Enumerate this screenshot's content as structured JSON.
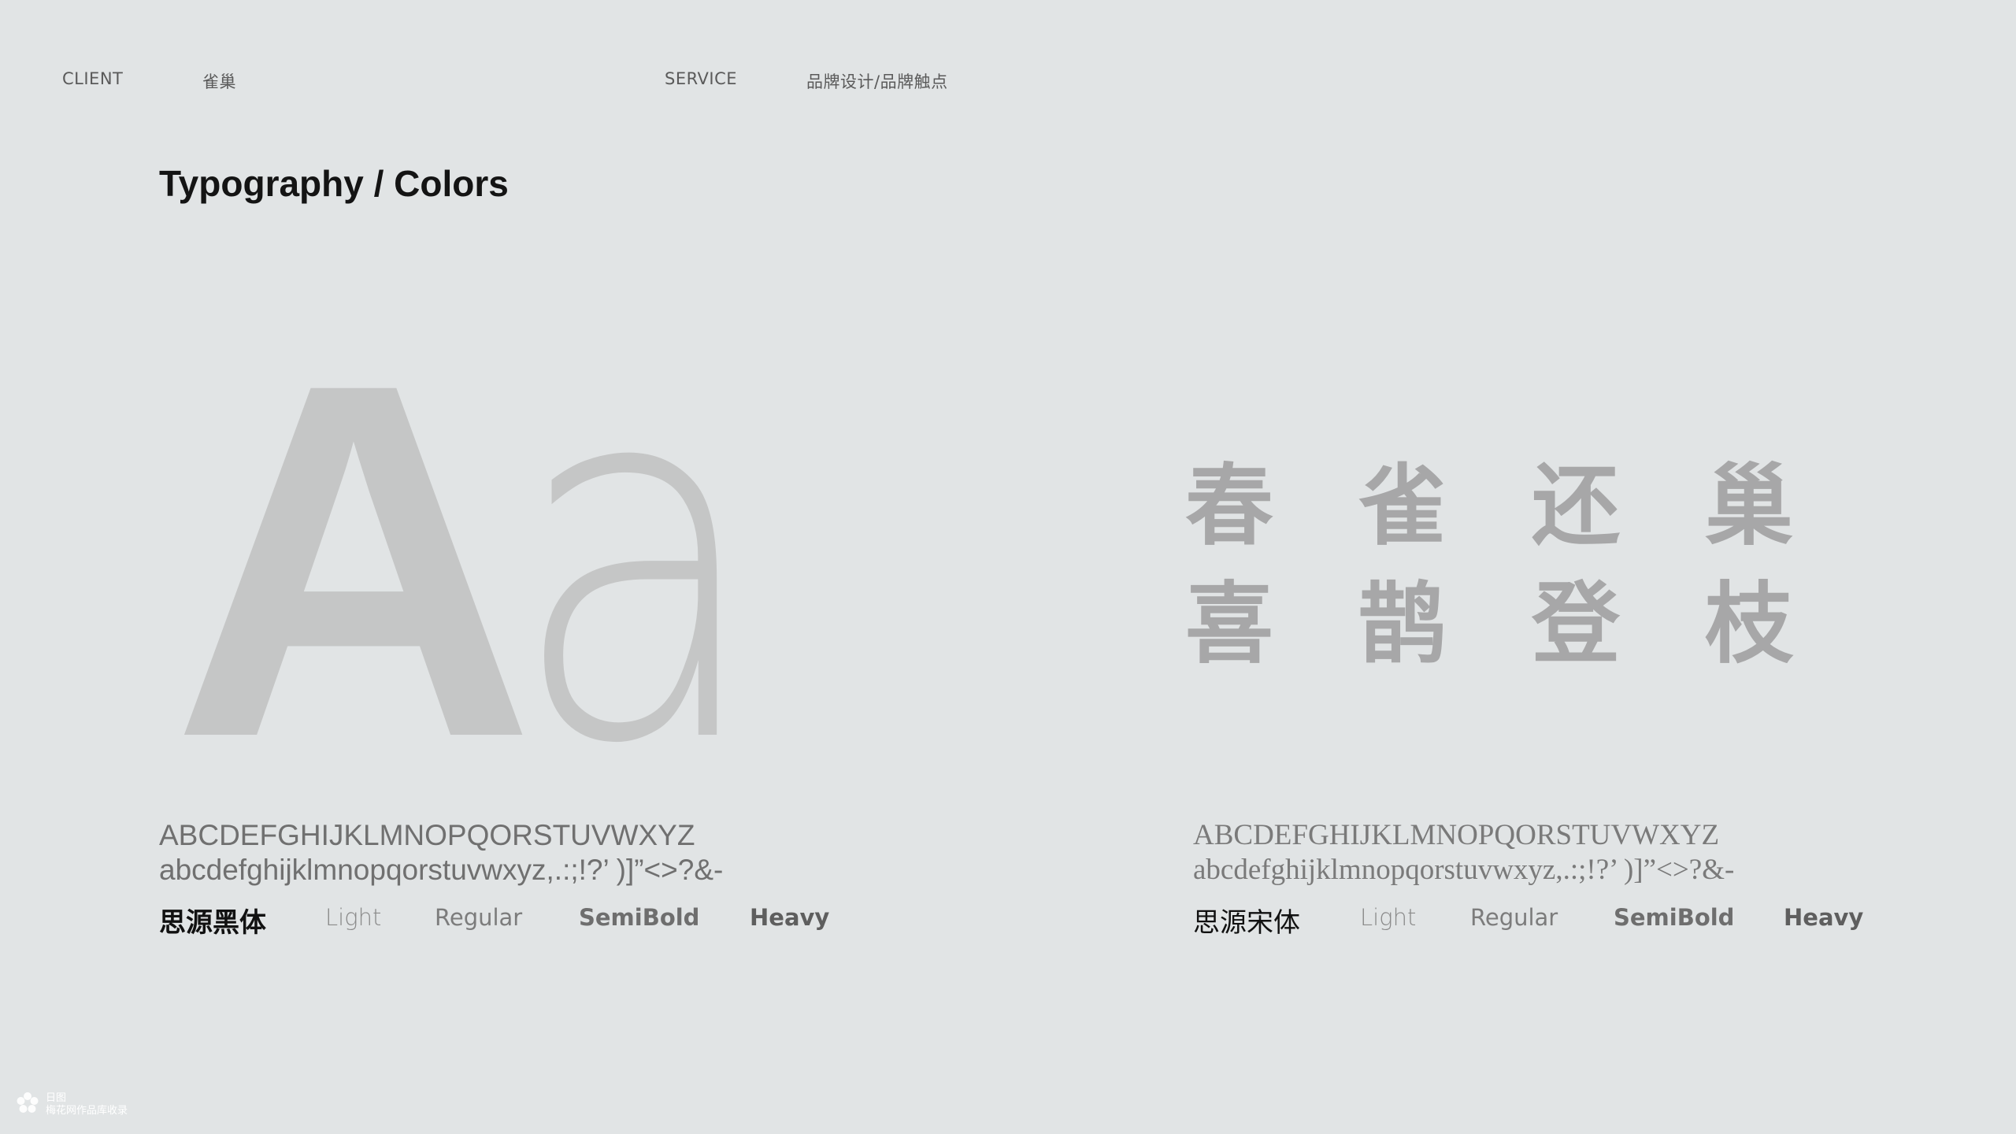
{
  "header": {
    "client_label": "CLIENT",
    "client_value": "雀巢",
    "service_label": "SERVICE",
    "service_value": "品牌设计/品牌触点"
  },
  "title": "Typography / Colors",
  "specimen": {
    "upper": "A",
    "lower": "a"
  },
  "cjk_chars": [
    "春",
    "雀",
    "还",
    "巢",
    "喜",
    "鹊",
    "登",
    "枝"
  ],
  "sans": {
    "uppercase": "ABCDEFGHIJKLMNOPQORSTUVWXYZ",
    "lowercase": "abcdefghijklmnopqorstuvwxyz,.:;!?’ )]”<>?&-",
    "font_name": "思源黑体",
    "weights": [
      "Light",
      "Regular",
      "SemiBold",
      "Heavy"
    ]
  },
  "serif": {
    "uppercase": "ABCDEFGHIJKLMNOPQORSTUVWXYZ",
    "lowercase": "abcdefghijklmnopqorstuvwxyz,.:;!?’ )]”<>?&-",
    "font_name": "思源宋体",
    "weights": [
      "Light",
      "Regular",
      "SemiBold",
      "Heavy"
    ]
  },
  "footer": {
    "line1": "日图",
    "line2": "梅花网作品库收录"
  },
  "colors": {
    "background": "#e1e4e5",
    "specimen": "#c5c6c6",
    "cjk": "#a7a7a8"
  },
  "icons": {
    "footer": "flower-logo-icon"
  }
}
